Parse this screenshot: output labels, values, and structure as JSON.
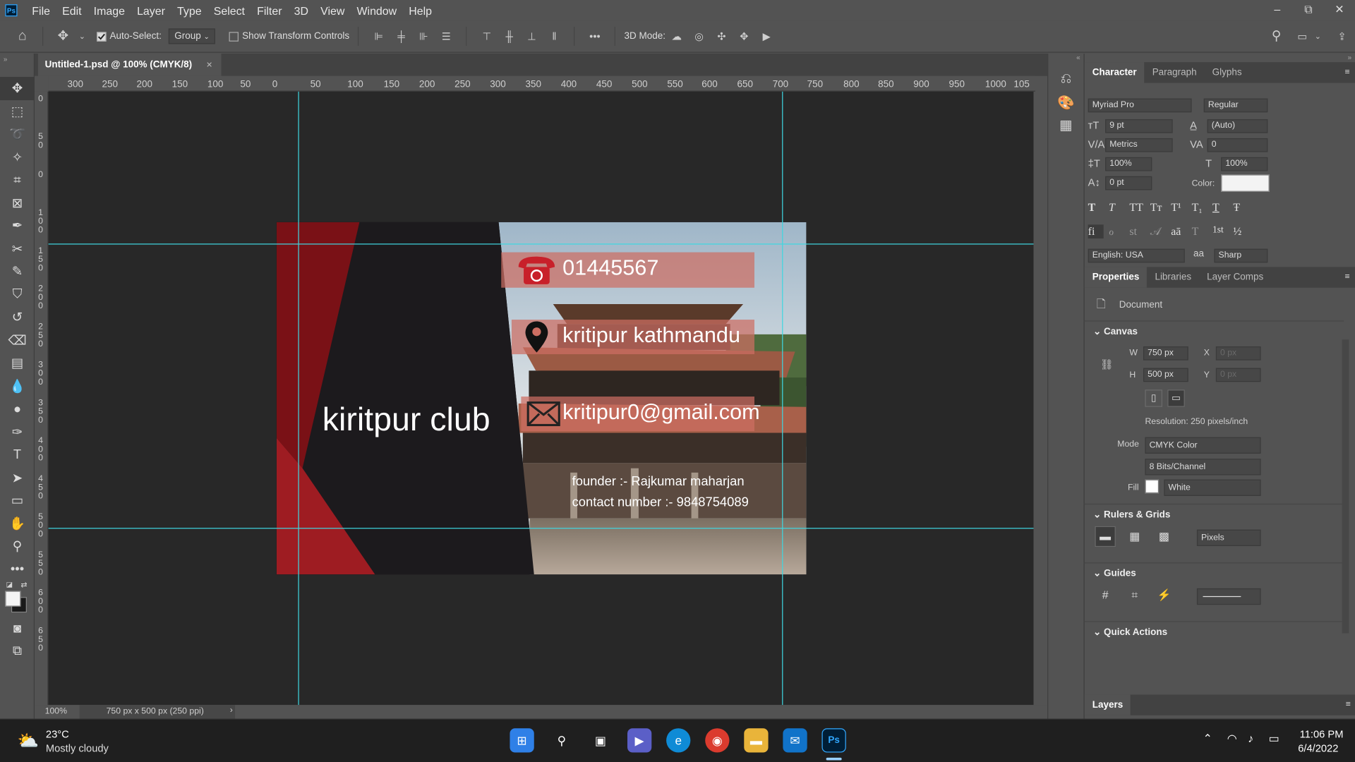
{
  "app": {
    "logo": "Ps",
    "accent": "#31a8ff"
  },
  "menu": [
    "File",
    "Edit",
    "Image",
    "Layer",
    "Type",
    "Select",
    "Filter",
    "3D",
    "View",
    "Window",
    "Help"
  ],
  "window_controls": {
    "minimize": "–",
    "restore": "⧉",
    "close": "✕"
  },
  "options_bar": {
    "auto_select_label": "Auto-Select:",
    "auto_select_checked": true,
    "auto_select_target": "Group",
    "transform_controls_label": "Show Transform Controls",
    "more": "•••",
    "mode3d_label": "3D Mode:"
  },
  "document": {
    "tab_title": "Untitled-1.psd @ 100% (CMYK/8)",
    "tab_close": "✕",
    "zoom": "100%",
    "size_info": "750 px x 500 px (250 ppi)",
    "status_arrow": "›"
  },
  "rulers": {
    "horizontal": [
      "300",
      "250",
      "200",
      "150",
      "100",
      "50",
      "0",
      "50",
      "100",
      "150",
      "200",
      "250",
      "300",
      "350",
      "400",
      "450",
      "500",
      "550",
      "600",
      "650",
      "700",
      "750",
      "800",
      "850",
      "900",
      "950",
      "1000",
      "105"
    ],
    "vertical": [
      "0",
      "50",
      "0",
      "100",
      "150",
      "200",
      "250",
      "300",
      "350",
      "400",
      "450",
      "500",
      "550",
      "600",
      "650"
    ]
  },
  "artwork": {
    "phone": "01445567",
    "address": "kritipur kathmandu",
    "email": "kritipur0@gmail.com",
    "club": "kiritpur club",
    "founder": "founder :- Rajkumar maharjan",
    "contact": "contact number :- 9848754089",
    "colors": {
      "red_dark": "#7a1116",
      "red": "#9e1c22",
      "panel": "#1c1a1d",
      "band": "#cd6e62"
    }
  },
  "character_panel": {
    "tabs": [
      "Character",
      "Paragraph",
      "Glyphs"
    ],
    "font_family": "Myriad Pro",
    "font_style": "Regular",
    "size": "9 pt",
    "leading": "(Auto)",
    "kerning": "Metrics",
    "tracking": "0",
    "vertical_scale": "100%",
    "horizontal_scale": "100%",
    "baseline_shift": "0 pt",
    "color_label": "Color:",
    "style_buttons": [
      "T",
      "T",
      "TT",
      "Tт",
      "T¹",
      "T₁",
      "T",
      "Ŧ"
    ],
    "opentype_buttons": [
      "fi",
      "ℴ",
      "st",
      "𝒜",
      "aā",
      "T",
      "1st",
      "½"
    ],
    "language": "English: USA",
    "aa_icon": "aa",
    "antialias": "Sharp"
  },
  "properties_panel": {
    "tabs": [
      "Properties",
      "Libraries",
      "Layer Comps"
    ],
    "document_label": "Document",
    "canvas_header": "Canvas",
    "w_label": "W",
    "w_value": "750 px",
    "h_label": "H",
    "h_value": "500 px",
    "x_label": "X",
    "x_placeholder": "0 px",
    "y_label": "Y",
    "y_placeholder": "0 px",
    "resolution": "Resolution: 250 pixels/inch",
    "mode_label": "Mode",
    "mode_value": "CMYK Color",
    "bits_value": "8 Bits/Channel",
    "fill_label": "Fill",
    "fill_value": "White",
    "rulers_header": "Rulers & Grids",
    "units_value": "Pixels",
    "guides_header": "Guides",
    "quick_actions_header": "Quick Actions"
  },
  "layers_panel": {
    "title": "Layers"
  },
  "taskbar": {
    "temperature": "23°C",
    "weather": "Mostly cloudy",
    "time": "11:06 PM",
    "date": "6/4/2022"
  }
}
